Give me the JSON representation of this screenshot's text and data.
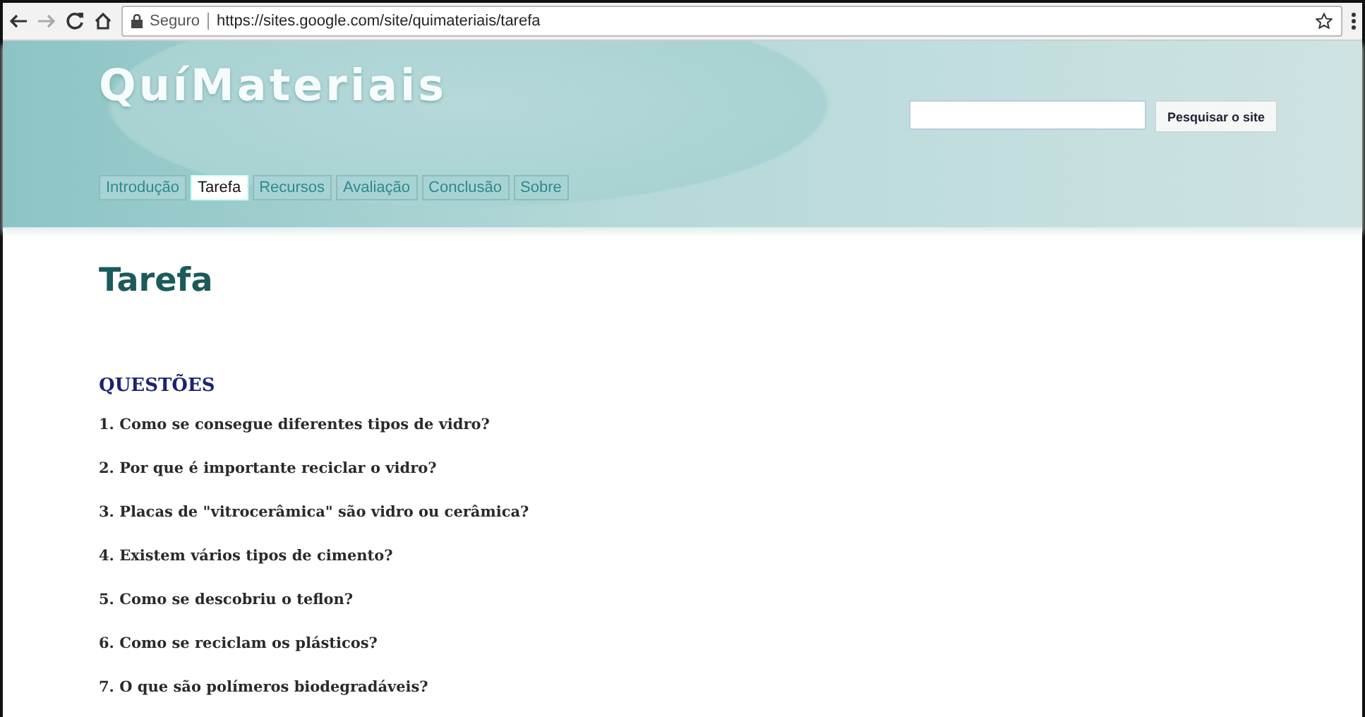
{
  "browser": {
    "security_label": "Seguro",
    "url": "https://sites.google.com/site/quimateriais/tarefa"
  },
  "site": {
    "title": "QuíMateriais",
    "search_button": "Pesquisar o site"
  },
  "tabs": [
    {
      "label": "Introdução",
      "selected": false
    },
    {
      "label": "Tarefa",
      "selected": true
    },
    {
      "label": "Recursos",
      "selected": false
    },
    {
      "label": "Avaliação",
      "selected": false
    },
    {
      "label": "Conclusão",
      "selected": false
    },
    {
      "label": "Sobre",
      "selected": false
    }
  ],
  "page": {
    "title": "Tarefa",
    "section_heading": "QUESTÕES",
    "questions": [
      "1. Como se consegue diferentes tipos de vidro?",
      "2. Por que é importante reciclar o vidro?",
      "3. Placas de \"vitrocerâmica\" são vidro ou cerâmica?",
      "4. Existem vários tipos de cimento?",
      "5. Como se descobriu o teflon?",
      "6. Como se reciclam os plásticos?",
      "7. O que são polímeros biodegradáveis?"
    ]
  }
}
